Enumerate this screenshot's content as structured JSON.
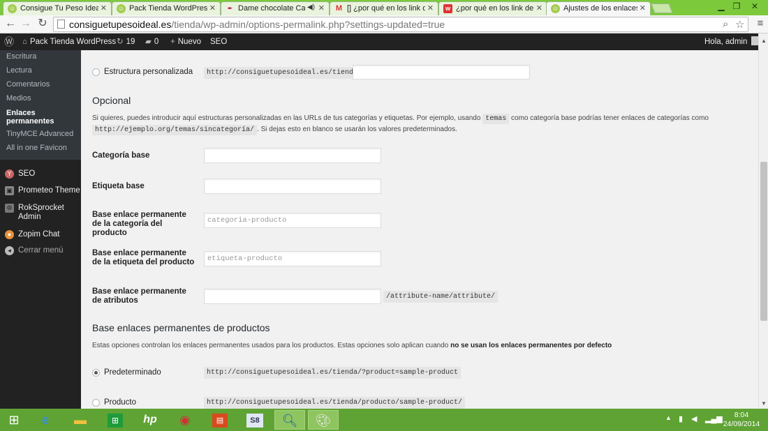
{
  "colors": {
    "chrome_green": "#7cc93b",
    "wp_adminbar": "#222222",
    "wp_sidebar": "#222222",
    "taskbar": "#5fa334"
  },
  "tabs": [
    {
      "title": "Consigue Tu Peso Ideal.es",
      "favicon": "site-favicon-icon",
      "active": false
    },
    {
      "title": "Pack Tienda WordPress »",
      "favicon": "site-favicon-icon",
      "active": false
    },
    {
      "title": "Dame chocolate Capit",
      "favicon": "feather-icon",
      "active": false
    },
    {
      "title": "[] ¿por qué en los link de l",
      "favicon": "gmail-icon",
      "active": false
    },
    {
      "title": "¿por qué en los link de las",
      "favicon": "w-icon",
      "active": false
    },
    {
      "title": "Ajustes de los enlaces perm",
      "favicon": "site-favicon-icon",
      "active": true
    }
  ],
  "browser": {
    "url_domain": "consiguetupesoideal.es",
    "url_path": "/tienda/wp-admin/options-permalink.php?settings-updated=true"
  },
  "adminbar": {
    "site_name": "Pack Tienda WordPress",
    "updates_count": "19",
    "comments_count": "0",
    "new_label": "Nuevo",
    "seo_label": "SEO",
    "greeting": "Hola, admin"
  },
  "sidebar": {
    "submenu": [
      "Escritura",
      "Lectura",
      "Comentarios",
      "Medios",
      "Enlaces permanentes",
      "TinyMCE Advanced",
      "All in one Favicon"
    ],
    "current_submenu": "Enlaces permanentes",
    "menu": [
      {
        "label": "SEO",
        "icon": "seo-icon"
      },
      {
        "label": "Prometeo Theme",
        "icon": "theme-icon"
      },
      {
        "label": "RokSprocket Admin",
        "icon": "rocket-icon"
      },
      {
        "label": "Zopim Chat",
        "icon": "chat-icon"
      },
      {
        "label": "Cerrar menú",
        "icon": "collapse-icon"
      }
    ]
  },
  "content": {
    "custom_structure": {
      "label": "Estructura personalizada",
      "prefix": "http://consiguetupesoideal.es/tienda",
      "value": ""
    },
    "optional": {
      "heading": "Opcional",
      "desc_before": "Si quieres, puedes introducir aquí estructuras personalizadas en las URLs de tus categorías y etiquetas. Por ejemplo, usando",
      "desc_code1": "temas",
      "desc_middle": "como categoría base podrías tener enlaces de categorías como",
      "desc_code2": "http://ejemplo.org/temas/sincategoría/",
      "desc_after": ". Si dejas esto en blanco se usarán los valores predeterminados."
    },
    "fields": [
      {
        "label": "Categoría base",
        "placeholder": ""
      },
      {
        "label": "Etiqueta base",
        "placeholder": ""
      },
      {
        "label": "Base enlace permanente de la categoría del producto",
        "placeholder": "categoria-producto"
      },
      {
        "label": "Base enlace permanente de la etiqueta del producto",
        "placeholder": "etiqueta-producto"
      },
      {
        "label": "Base enlace permanente de atributos",
        "placeholder": "",
        "suffix": "/attribute-name/attribute/"
      }
    ],
    "products": {
      "heading": "Base enlaces permanentes de productos",
      "desc": "Estas opciones controlan los enlaces permanentes usados para los productos. Estas opciones solo aplican cuando",
      "desc_bold": "no se usan los enlaces permanentes por defecto",
      "options": [
        {
          "label": "Predeterminado",
          "example": "http://consiguetupesoideal.es/tienda/?product=sample-product",
          "checked": true
        },
        {
          "label": "Producto",
          "example": "http://consiguetupesoideal.es/tienda/producto/sample-product/",
          "checked": false
        }
      ]
    }
  },
  "taskbar": {
    "apps": [
      "windows-start-icon",
      "internet-explorer-icon",
      "file-explorer-icon",
      "store-icon",
      "hp-icon",
      "chrome-icon",
      "app-icon",
      "s8-icon",
      "magnifier-icon",
      "paint-icon"
    ],
    "s8_label": "S8",
    "time": "8:04",
    "date": "24/09/2014"
  }
}
